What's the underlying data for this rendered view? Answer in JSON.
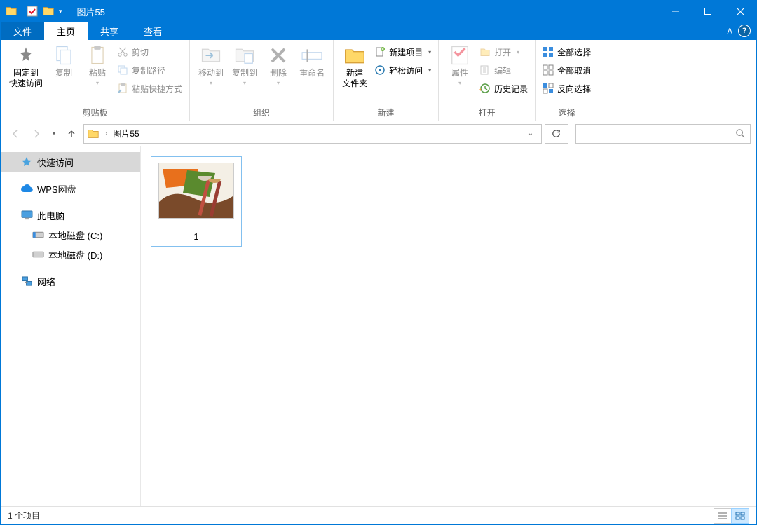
{
  "window": {
    "title": "图片55"
  },
  "tabs": {
    "file": "文件",
    "home": "主页",
    "share": "共享",
    "view": "查看"
  },
  "ribbon": {
    "clipboard": {
      "label": "剪贴板",
      "pin": "固定到\n快速访问",
      "copy": "复制",
      "paste": "粘贴",
      "cut": "剪切",
      "copy_path": "复制路径",
      "paste_shortcut": "粘贴快捷方式"
    },
    "organize": {
      "label": "组织",
      "move_to": "移动到",
      "copy_to": "复制到",
      "delete": "删除",
      "rename": "重命名"
    },
    "new": {
      "label": "新建",
      "new_folder": "新建\n文件夹",
      "new_item": "新建项目",
      "easy_access": "轻松访问"
    },
    "open": {
      "label": "打开",
      "properties": "属性",
      "open": "打开",
      "edit": "编辑",
      "history": "历史记录"
    },
    "select": {
      "label": "选择",
      "select_all": "全部选择",
      "select_none": "全部取消",
      "invert": "反向选择"
    }
  },
  "address": {
    "path": "图片55"
  },
  "nav": {
    "quick_access": "快速访问",
    "wps": "WPS网盘",
    "this_pc": "此电脑",
    "drive_c": "本地磁盘 (C:)",
    "drive_d": "本地磁盘 (D:)",
    "network": "网络"
  },
  "content": {
    "items": [
      {
        "name": "1"
      }
    ]
  },
  "status": {
    "count": "1 个项目"
  }
}
